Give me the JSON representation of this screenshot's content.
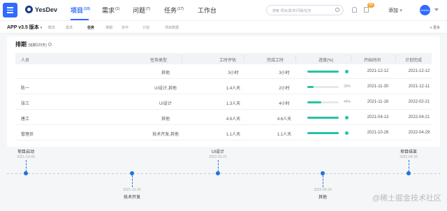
{
  "header": {
    "logo": "YesDev",
    "nav": [
      {
        "label": "项目",
        "count": "(10)"
      },
      {
        "label": "需求",
        "count": "(1)"
      },
      {
        "label": "问题",
        "count": "(7)"
      },
      {
        "label": "任务",
        "count": "(17)"
      },
      {
        "label": "工作台",
        "count": ""
      }
    ],
    "search_placeholder": "搜索 项目/需求/问题/任务",
    "notify_badge": "99",
    "add_label": "添加 +",
    "avatar_text": "YesDev"
  },
  "subbar": {
    "version": "APP v3.5 版本",
    "version_arrow": "▾",
    "tabs": [
      "概览",
      "需求",
      "任务",
      "排期",
      "协作",
      "计划",
      "项目数据"
    ],
    "more": "≡ 更多"
  },
  "card": {
    "title": "排期",
    "subtitle": "(延期120天)",
    "columns": [
      "人员",
      "任务类型",
      "工时评估",
      "完成工时",
      "进度(%)",
      "开始时间",
      "计划完成"
    ],
    "rows": [
      {
        "person": "",
        "type": "其他",
        "estimate": "3小时",
        "done": "3小时",
        "progress": 100,
        "progress_text": "",
        "start": "2021-12-12",
        "end": "2021-12-12"
      },
      {
        "person": "陈一",
        "type": "UI设计,其他",
        "estimate": "1.4人天",
        "done": "2小时",
        "progress": 20,
        "progress_text": "20%",
        "start": "2021-11-30",
        "end": "2021-12-11"
      },
      {
        "person": "张三",
        "type": "UI设计",
        "estimate": "1.3人天",
        "done": "4小时",
        "progress": 44,
        "progress_text": "44%",
        "start": "2021-11-18",
        "end": "2022-02-21"
      },
      {
        "person": "唐工",
        "type": "其他",
        "estimate": "4.6人天",
        "done": "4.6人天",
        "progress": 100,
        "progress_text": "",
        "start": "2021-04-13",
        "end": "2022-04-21"
      },
      {
        "person": "管理员",
        "type": "技术开发,其他",
        "estimate": "1.1人天",
        "done": "1.1人天",
        "progress": 100,
        "progress_text": "",
        "start": "2021-10-26",
        "end": "2022-04-29"
      }
    ]
  },
  "timeline": {
    "above": [
      {
        "label": "项目启动",
        "date": "2021-10-05"
      },
      {
        "label": "UI设计",
        "date": "2022-03-21"
      },
      {
        "label": "项目结束",
        "date": "2022-04-29"
      }
    ],
    "below": [
      {
        "label": "技术开发",
        "date": "2021-10-26"
      },
      {
        "label": "其他",
        "date": "2022-04-29"
      }
    ]
  },
  "watermark": "@稀土掘金技术社区"
}
